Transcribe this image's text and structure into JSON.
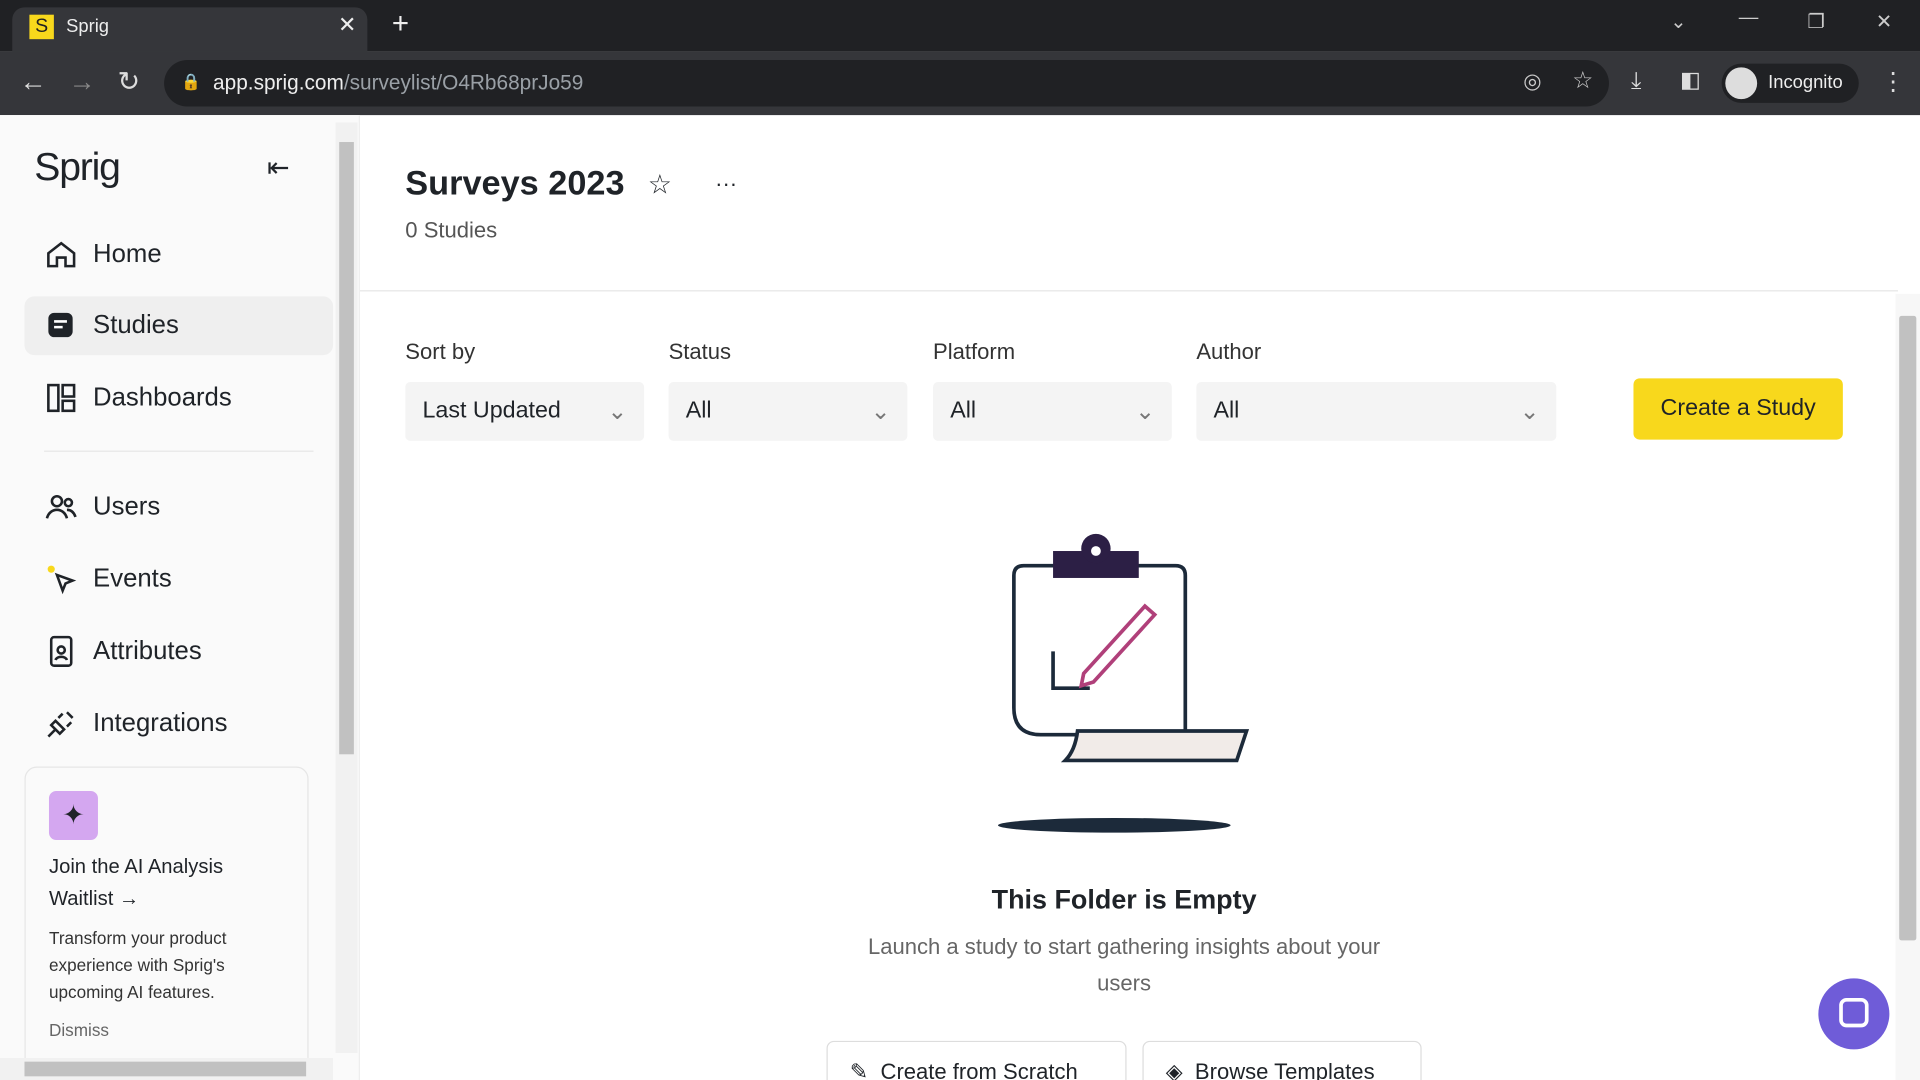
{
  "browser": {
    "tab_title": "Sprig",
    "favicon": "S",
    "url_host": "app.sprig.com",
    "url_path": "/surveylist/O4Rb68prJo59",
    "profile": "Incognito"
  },
  "sidebar": {
    "logo": "Sprig",
    "items": [
      {
        "label": "Home",
        "icon": "home-icon"
      },
      {
        "label": "Studies",
        "icon": "studies-icon",
        "active": true
      },
      {
        "label": "Dashboards",
        "icon": "dashboards-icon"
      },
      {
        "label": "Users",
        "icon": "users-icon"
      },
      {
        "label": "Events",
        "icon": "events-icon"
      },
      {
        "label": "Attributes",
        "icon": "attributes-icon"
      },
      {
        "label": "Integrations",
        "icon": "integrations-icon"
      }
    ],
    "promo": {
      "title": "Join the AI Analysis Waitlist →",
      "body": "Transform your product experience with Sprig's upcoming AI features.",
      "dismiss": "Dismiss"
    }
  },
  "header": {
    "title": "Surveys 2023",
    "subtitle": "0 Studies",
    "more": "···"
  },
  "filters": [
    {
      "label": "Sort by",
      "value": "Last Updated"
    },
    {
      "label": "Status",
      "value": "All"
    },
    {
      "label": "Platform",
      "value": "All"
    },
    {
      "label": "Author",
      "value": "All"
    }
  ],
  "create_button": "Create a Study",
  "empty": {
    "title": "This Folder is Empty",
    "body": "Launch a study to start gathering insights about your users",
    "scratch": "Create from Scratch",
    "templates": "Browse Templates"
  },
  "colors": {
    "accent": "#f8d81c",
    "promo_icon_bg": "#d4a7f0"
  }
}
